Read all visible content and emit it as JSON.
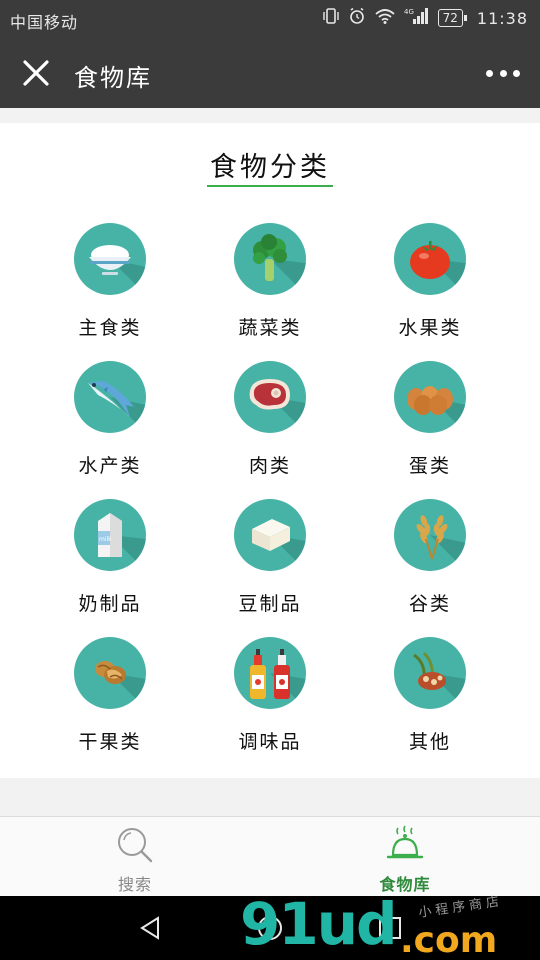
{
  "status_bar": {
    "carrier": "中国移动",
    "network": "4G",
    "battery": "72",
    "time": "11:38",
    "icons": [
      "vibrate-icon",
      "alarm-icon",
      "wifi-icon",
      "signal-icon",
      "battery-icon"
    ]
  },
  "header": {
    "title": "食物库",
    "close_icon": "close-icon",
    "more_icon": "more-icon"
  },
  "section": {
    "title": "食物分类",
    "accent_color": "#3cae4c"
  },
  "categories": [
    {
      "label": "主食类",
      "icon": "rice-bowl-icon"
    },
    {
      "label": "蔬菜类",
      "icon": "broccoli-icon"
    },
    {
      "label": "水果类",
      "icon": "tomato-icon"
    },
    {
      "label": "水产类",
      "icon": "fish-icon"
    },
    {
      "label": "肉类",
      "icon": "steak-icon"
    },
    {
      "label": "蛋类",
      "icon": "eggs-icon"
    },
    {
      "label": "奶制品",
      "icon": "milk-carton-icon"
    },
    {
      "label": "豆制品",
      "icon": "tofu-icon"
    },
    {
      "label": "谷类",
      "icon": "wheat-icon"
    },
    {
      "label": "干果类",
      "icon": "walnut-icon"
    },
    {
      "label": "调味品",
      "icon": "sauce-bottles-icon"
    },
    {
      "label": "其他",
      "icon": "other-food-icon"
    }
  ],
  "category_circle_color": "#47b3a6",
  "tab_bar": {
    "tabs": [
      {
        "label": "搜索",
        "icon": "search-icon",
        "active": false
      },
      {
        "label": "食物库",
        "icon": "food-cloche-icon",
        "active": true
      }
    ],
    "active_color": "#2f8a3b"
  },
  "watermark": {
    "main": "91ud",
    "dotcom": ".com",
    "sub": "小程序商店"
  }
}
